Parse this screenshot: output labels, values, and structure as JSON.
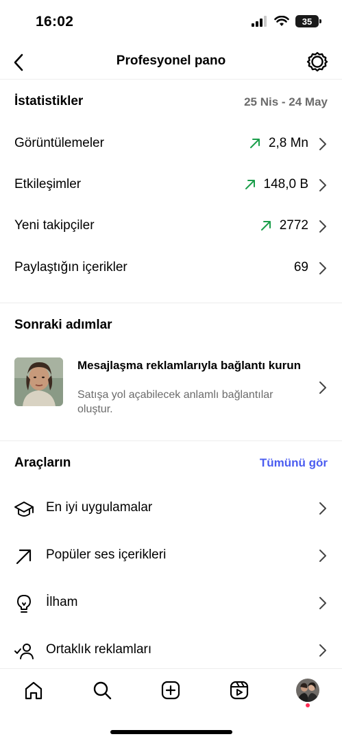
{
  "status_bar": {
    "time": "16:02",
    "battery": "35"
  },
  "nav": {
    "title": "Profesyonel pano"
  },
  "stats": {
    "heading": "İstatistikler",
    "date_range": "25 Nis - 24 May",
    "rows": [
      {
        "label": "Görüntülemeler",
        "value": "2,8 Mn",
        "trend": "up"
      },
      {
        "label": "Etkileşimler",
        "value": "148,0 B",
        "trend": "up"
      },
      {
        "label": "Yeni takipçiler",
        "value": "2772",
        "trend": "up"
      },
      {
        "label": "Paylaştığın içerikler",
        "value": "69",
        "trend": "none"
      }
    ]
  },
  "next_steps": {
    "heading": "Sonraki adımlar",
    "card": {
      "title": "Mesajlaşma reklamlarıyla bağlantı kurun",
      "subtitle": "Satışa yol açabilecek anlamlı bağlantılar oluştur."
    }
  },
  "tools": {
    "heading": "Araçların",
    "see_all": "Tümünü gör",
    "items": [
      {
        "label": "En iyi uygulamalar",
        "icon": "graduation-cap-icon"
      },
      {
        "label": "Popüler ses içerikleri",
        "icon": "arrow-up-right-icon"
      },
      {
        "label": "İlham",
        "icon": "lightbulb-icon"
      },
      {
        "label": "Ortaklık reklamları",
        "icon": "partner-user-icon"
      }
    ]
  },
  "tab_bar": {
    "items": [
      "home-icon",
      "search-icon",
      "create-icon",
      "reels-icon",
      "profile-avatar"
    ]
  },
  "colors": {
    "accent": "#4a5cf0",
    "trend_up": "#1a9e4a",
    "muted": "#6b6b6b",
    "notif": "#ff2d55"
  }
}
